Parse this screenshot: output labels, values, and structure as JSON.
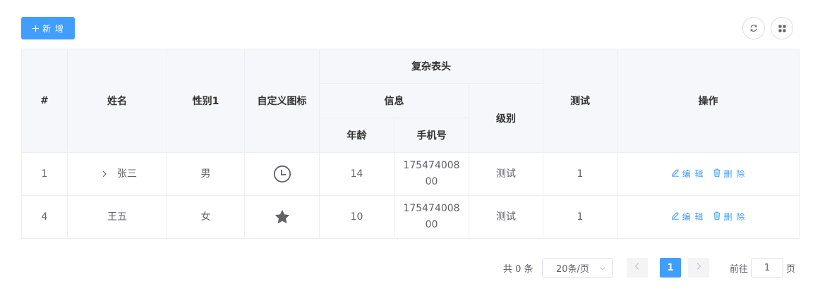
{
  "toolbar": {
    "add_label": "新 增",
    "add_icon": "plus-icon",
    "refresh_icon": "refresh-icon",
    "columns_icon": "grid-icon"
  },
  "table": {
    "headers": {
      "index": "#",
      "name": "姓名",
      "gender": "性别1",
      "custom_icon": "自定义图标",
      "complex": "复杂表头",
      "info": "信息",
      "age": "年龄",
      "phone": "手机号",
      "level": "级别",
      "test": "测试",
      "actions": "操作"
    },
    "rows": [
      {
        "index": "1",
        "name": "张三",
        "expandable": true,
        "gender": "男",
        "icon": "clock-icon",
        "age": "14",
        "phone": "17547400800",
        "level": "测试",
        "test": "1",
        "edit_label": "编 辑",
        "delete_label": "删 除"
      },
      {
        "index": "4",
        "name": "王五",
        "expandable": false,
        "gender": "女",
        "icon": "star-icon",
        "age": "10",
        "phone": "17547400800",
        "level": "测试",
        "test": "1",
        "edit_label": "编 辑",
        "delete_label": "删 除"
      }
    ]
  },
  "pagination": {
    "total_text": "共 0 条",
    "page_size": "20条/页",
    "current_page": "1",
    "goto_prefix": "前往",
    "goto_value": "1",
    "goto_suffix": "页"
  },
  "colors": {
    "primary": "#409eff",
    "header_bg": "#f5f7fa",
    "border": "#ebeef5"
  }
}
